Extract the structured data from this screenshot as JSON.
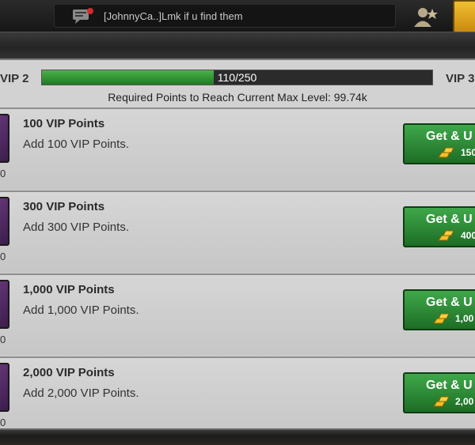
{
  "chat": {
    "icon": "chat-bubble-icon",
    "message": "[JohnnyCa..]Lmk if u find them"
  },
  "vip": {
    "current_level": "VIP 2",
    "next_level": "VIP 3",
    "progress_text": "110/250",
    "progress_fraction": 0.44,
    "required_text": "Required Points to Reach Current Max Level: 99.74k"
  },
  "items": [
    {
      "title": "100 VIP Points",
      "desc": "Add 100 VIP Points.",
      "count": "0",
      "button": "Get & U",
      "price": "150"
    },
    {
      "title": "300 VIP Points",
      "desc": "Add 300 VIP Points.",
      "count": "0",
      "button": "Get & U",
      "price": "400"
    },
    {
      "title": "1,000 VIP Points",
      "desc": "Add 1,000 VIP Points.",
      "count": "0",
      "button": "Get & U",
      "price": "1,00"
    },
    {
      "title": "2,000 VIP Points",
      "desc": "Add 2,000 VIP Points.",
      "count": "0",
      "button": "Get & U",
      "price": "2,00"
    }
  ],
  "colors": {
    "button_green": "#2e8b3a",
    "progress_green": "#3aa13c",
    "gold": "#e8b020"
  }
}
